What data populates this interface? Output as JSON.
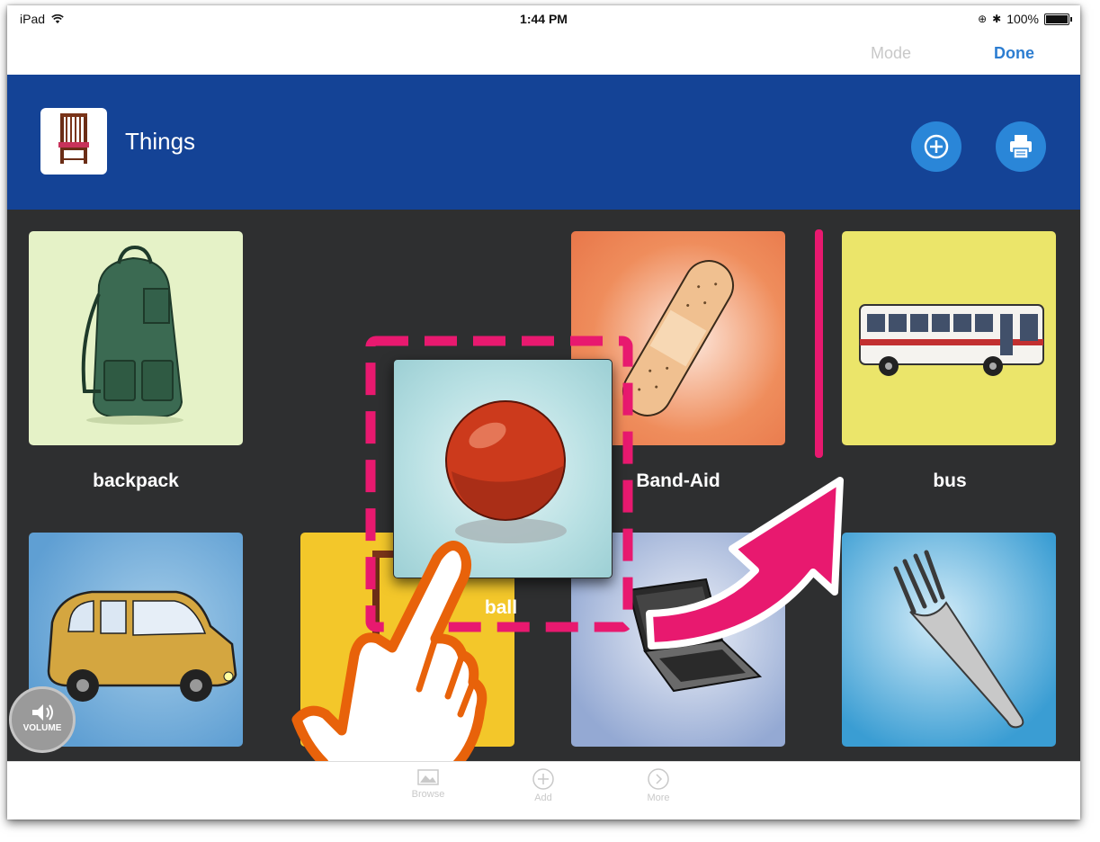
{
  "status_bar": {
    "device": "iPad",
    "time": "1:44 PM",
    "battery": "100%"
  },
  "nav": {
    "mode_label": "Mode",
    "done_label": "Done"
  },
  "header": {
    "title": "Things"
  },
  "tiles": [
    {
      "label": "backpack"
    },
    {
      "label": "Band-Aid"
    },
    {
      "label": "bus"
    },
    {
      "label": "ball"
    }
  ],
  "tabbar": {
    "browse_label": "Browse",
    "add_label": "Add",
    "more_label": "More"
  },
  "volume": {
    "label": "VOLUME"
  },
  "colors": {
    "header_bg": "#144396",
    "grid_bg": "#2e2f30",
    "accent": "#e8196f",
    "done": "#2c7dd1",
    "hand_outline": "#e8620a"
  }
}
